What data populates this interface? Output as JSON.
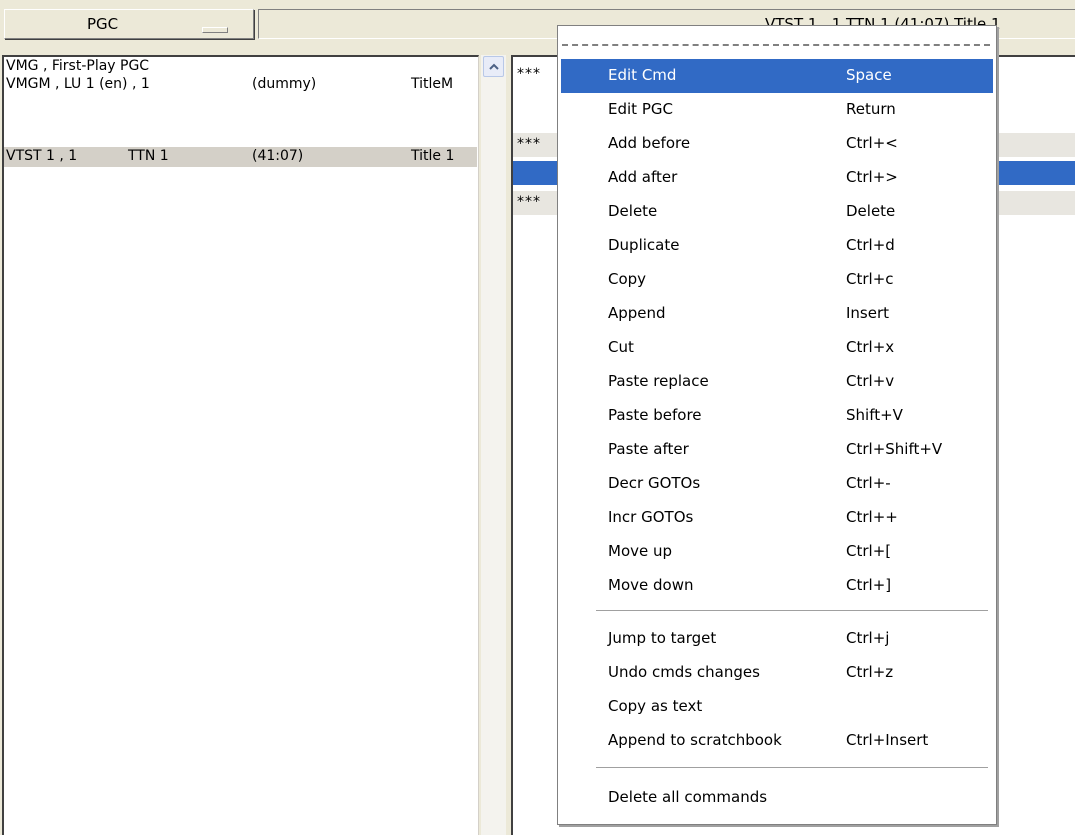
{
  "top": {
    "pgc_button_label": "PGC",
    "title_text": "VTST 1 , 1   TTN 1  (41:07)  Title 1"
  },
  "pgc_list": [
    {
      "c1": "VMG , First-Play PGC",
      "c2": "",
      "c3": "",
      "c4": ""
    },
    {
      "c1": "VMGM , LU 1 (en) , 1",
      "c2": "",
      "c3": "(dummy)",
      "c4": "TitleM"
    },
    {
      "c1": "",
      "c2": "",
      "c3": "",
      "c4": ""
    },
    {
      "c1": "VTST 1 , 1",
      "c2": "TTN 1",
      "c3": "(41:07)",
      "c4": "Title 1"
    }
  ],
  "cmd_list": [
    {
      "text": "***"
    },
    {
      "text": ""
    },
    {
      "text": "***"
    },
    {
      "text": ""
    },
    {
      "text": "***"
    }
  ],
  "menu": {
    "group1": [
      {
        "label": "Edit Cmd",
        "shortcut": "Space"
      },
      {
        "label": "Edit PGC",
        "shortcut": "Return"
      },
      {
        "label": "Add before",
        "shortcut": "Ctrl+<"
      },
      {
        "label": "Add after",
        "shortcut": "Ctrl+>"
      },
      {
        "label": "Delete",
        "shortcut": "Delete"
      },
      {
        "label": "Duplicate",
        "shortcut": "Ctrl+d"
      },
      {
        "label": "Copy",
        "shortcut": "Ctrl+c"
      },
      {
        "label": "Append",
        "shortcut": "Insert"
      },
      {
        "label": "Cut",
        "shortcut": "Ctrl+x"
      },
      {
        "label": "Paste replace",
        "shortcut": "Ctrl+v"
      },
      {
        "label": "Paste before",
        "shortcut": "Shift+V"
      },
      {
        "label": "Paste after",
        "shortcut": "Ctrl+Shift+V"
      },
      {
        "label": "Decr GOTOs",
        "shortcut": "Ctrl+-"
      },
      {
        "label": "Incr GOTOs",
        "shortcut": "Ctrl++"
      },
      {
        "label": "Move up",
        "shortcut": "Ctrl+["
      },
      {
        "label": "Move down",
        "shortcut": "Ctrl+]"
      }
    ],
    "group2": [
      {
        "label": "Jump to target",
        "shortcut": "Ctrl+j"
      },
      {
        "label": "Undo cmds changes",
        "shortcut": "Ctrl+z"
      },
      {
        "label": "Copy as text",
        "shortcut": ""
      },
      {
        "label": "Append to scratchbook",
        "shortcut": "Ctrl+Insert"
      }
    ],
    "group3": [
      {
        "label": "Delete all commands",
        "shortcut": ""
      }
    ]
  },
  "colors": {
    "highlight": "#316ac5",
    "window_bg": "#ece9d8",
    "selected_row": "#d4d0c8"
  },
  "icons": [
    "dropdown-icon",
    "scroll-up-arrow-icon"
  ]
}
